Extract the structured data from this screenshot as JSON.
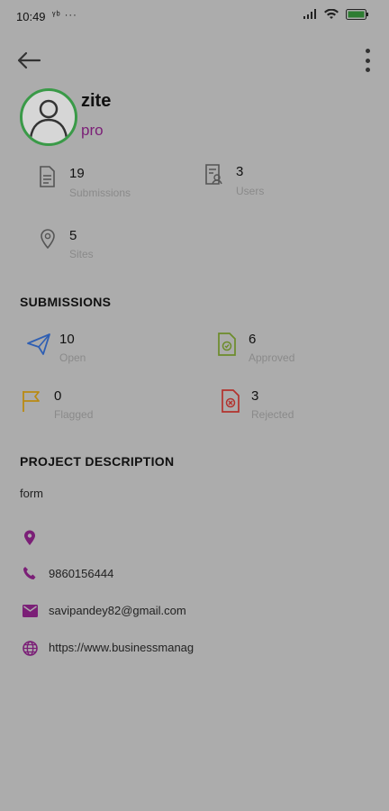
{
  "status": {
    "time": "10:49",
    "extra": "ᵞᵇ ···"
  },
  "profile": {
    "name": "zite",
    "subtitle": "pro"
  },
  "stats": [
    {
      "value": "19",
      "label": "Submissions"
    },
    {
      "value": "3",
      "label": "Users"
    },
    {
      "value": "5",
      "label": "Sites"
    }
  ],
  "submissions_section": {
    "title": "SUBMISSIONS",
    "items": [
      {
        "value": "10",
        "label": "Open"
      },
      {
        "value": "6",
        "label": "Approved"
      },
      {
        "value": "0",
        "label": "Flagged"
      },
      {
        "value": "3",
        "label": "Rejected"
      }
    ]
  },
  "description_section": {
    "title": "PROJECT DESCRIPTION",
    "text": "form"
  },
  "contacts": {
    "phone": "9860156444",
    "email": "savipandey82@gmail.com",
    "website": "https://www.businessmanag"
  },
  "colors": {
    "accent_purple": "#7b1f77",
    "avatar_ring": "#3a9a48",
    "background": "#acacac"
  }
}
